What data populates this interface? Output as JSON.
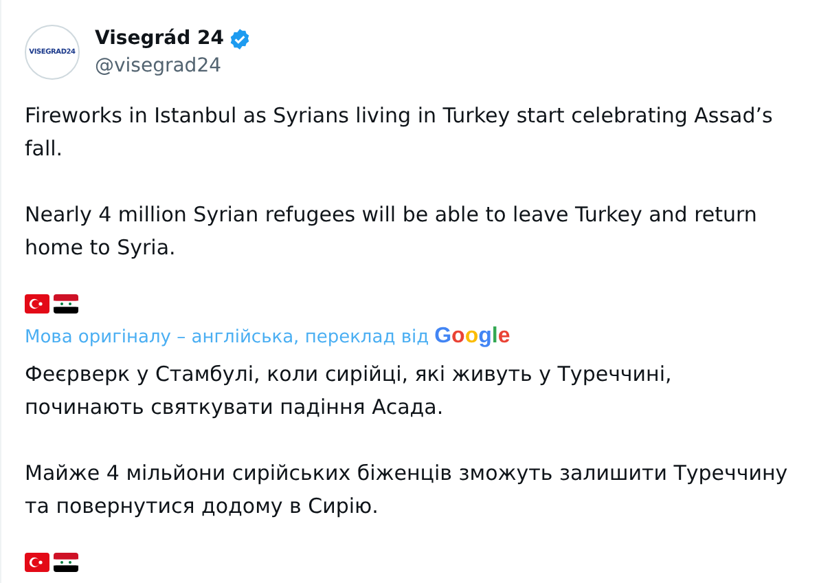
{
  "author": {
    "name": "Visegrád 24",
    "handle": "@visegrad24",
    "verified": true,
    "avatar_text": "VISEGRAD24"
  },
  "original": {
    "paragraphs": [
      "Fireworks in Istanbul as Syrians living in Turkey start celebrating Assad’s fall.",
      "Nearly 4 million Syrian refugees will be able to leave Turkey and return home to Syria."
    ],
    "flags": [
      {
        "kind": "turkey"
      },
      {
        "kind": "syria"
      }
    ]
  },
  "translation_note": {
    "text": "Мова оригіналу – англійська, переклад від",
    "provider": "Google"
  },
  "translated": {
    "paragraphs": [
      "Феєрверк у Стамбулі, коли сирійці, які живуть у Туреччині, починають святкувати падіння Асада.",
      "Майже 4 мільйони сирійських біженців зможуть залишити Туреччину та повернутися додому в Сирію."
    ],
    "flags": [
      {
        "kind": "turkey"
      },
      {
        "kind": "syria"
      }
    ]
  }
}
